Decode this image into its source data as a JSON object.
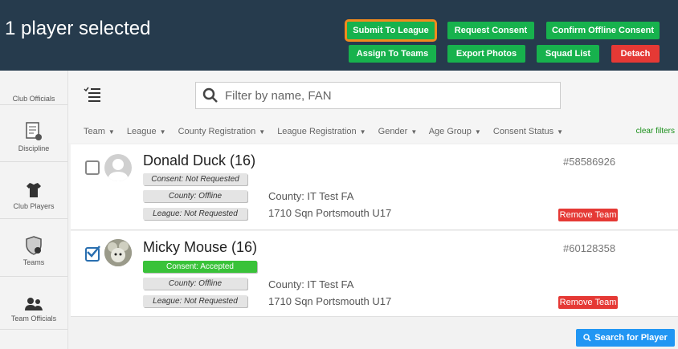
{
  "header": {
    "title": "1 player selected",
    "buttons_row1": [
      {
        "label": "Submit To League"
      },
      {
        "label": "Request Consent"
      },
      {
        "label": "Confirm Offline Consent"
      }
    ],
    "buttons_row2": [
      {
        "label": "Assign To Teams"
      },
      {
        "label": "Export Photos"
      },
      {
        "label": "Squad List"
      },
      {
        "label": "Detach"
      }
    ]
  },
  "sidebar": {
    "items": [
      {
        "label": "Club Officials",
        "icon": "club-officials-icon"
      },
      {
        "label": "Discipline",
        "icon": "discipline-icon"
      },
      {
        "label": "Club Players",
        "icon": "shirt-icon"
      },
      {
        "label": "Teams",
        "icon": "shield-icon"
      },
      {
        "label": "Team Officials",
        "icon": "team-officials-icon"
      }
    ]
  },
  "search": {
    "placeholder": "Filter by name, FAN"
  },
  "filters": {
    "items": [
      "Team",
      "League",
      "County Registration",
      "League Registration",
      "Gender",
      "Age Group",
      "Consent Status"
    ],
    "clear_label": "clear filters"
  },
  "players": [
    {
      "name": "Donald Duck (16)",
      "fan": "#58586926",
      "consent": "Consent: Not Requested",
      "county": "County: Offline",
      "league": "League: Not Requested",
      "county_detail": "County: IT Test FA",
      "team_detail": "1710 Sqn Portsmouth U17",
      "remove_label": "Remove Team",
      "checked": false
    },
    {
      "name": "Micky Mouse (16)",
      "fan": "#60128358",
      "consent": "Consent: Accepted",
      "county": "County: Offline",
      "league": "League: Not Requested",
      "county_detail": "County: IT Test FA",
      "team_detail": "1710 Sqn Portsmouth U17",
      "remove_label": "Remove Team",
      "checked": true
    }
  ],
  "footer": {
    "search_player_label": "Search for Player"
  },
  "colors": {
    "header_bg": "#263b4d",
    "green": "#17b24d",
    "red": "#e53935",
    "blue": "#2196f3",
    "highlight": "#f28a1d"
  }
}
